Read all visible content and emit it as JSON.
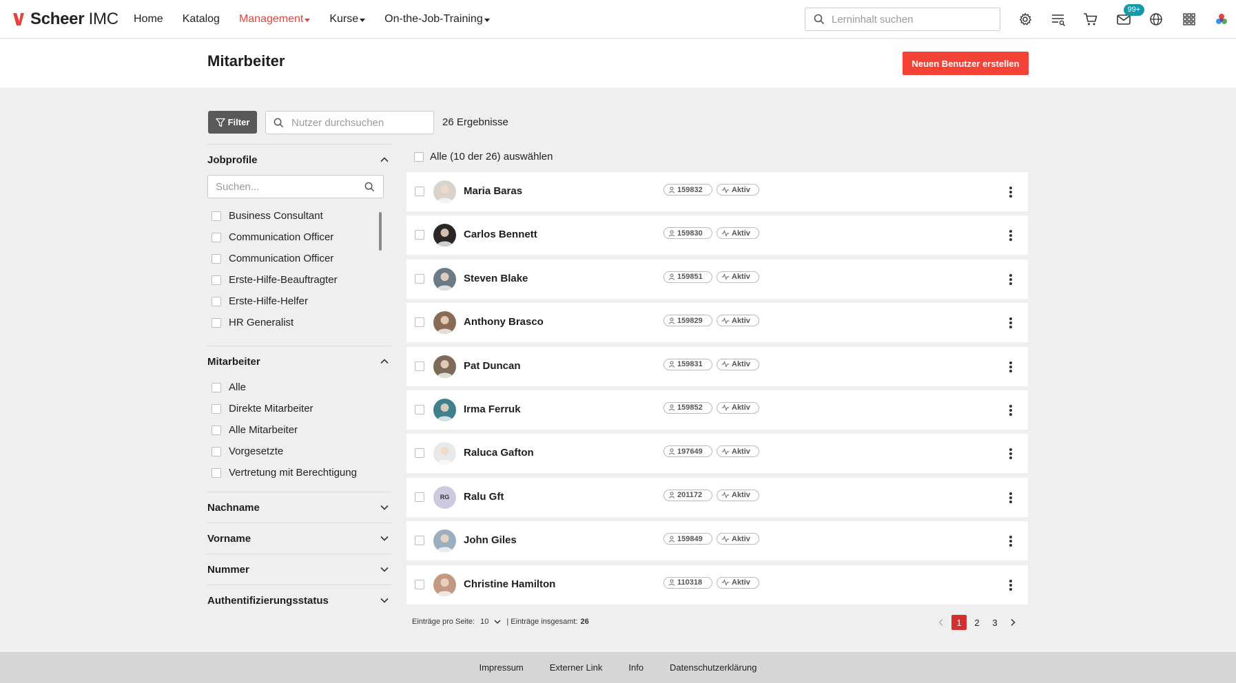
{
  "header": {
    "logo_brand": "Scheer",
    "logo_suffix": "IMC",
    "nav": [
      {
        "label": "Home"
      },
      {
        "label": "Katalog"
      },
      {
        "label": "Management"
      },
      {
        "label": "Kurse"
      },
      {
        "label": "On-the-Job-Training"
      }
    ],
    "active_nav": "Management",
    "search_placeholder": "Lerninhalt suchen",
    "icons": [
      "gear-icon",
      "filter-list-icon",
      "cart-icon",
      "mail-icon",
      "globe-icon",
      "apps-grid-icon",
      "brand-icon"
    ],
    "mail_badge": "99+"
  },
  "page": {
    "title": "Mitarbeiter",
    "create_button": "Neuen Benutzer erstellen",
    "filter_button": "Filter",
    "user_search_placeholder": "Nutzer durchsuchen",
    "results": "26 Ergebnisse",
    "select_all": "Alle (10 der 26) auswählen"
  },
  "sidebar": {
    "jobprofile": {
      "title": "Jobprofile",
      "search_placeholder": "Suchen...",
      "items": [
        {
          "label": "Business Consultant"
        },
        {
          "label": "Communication Officer"
        },
        {
          "label": "Communication Officer"
        },
        {
          "label": "Erste-Hilfe-Beauftragter"
        },
        {
          "label": "Erste-Hilfe-Helfer"
        },
        {
          "label": "HR Generalist"
        }
      ]
    },
    "mitarbeiter": {
      "title": "Mitarbeiter",
      "items": [
        {
          "label": "Alle"
        },
        {
          "label": "Direkte Mitarbeiter"
        },
        {
          "label": "Alle Mitarbeiter"
        },
        {
          "label": "Vorgesetzte"
        },
        {
          "label": "Vertretung mit Berechtigung"
        }
      ]
    },
    "collapsed": [
      {
        "title": "Nachname"
      },
      {
        "title": "Vorname"
      },
      {
        "title": "Nummer"
      },
      {
        "title": "Authentifizierungsstatus"
      }
    ]
  },
  "users": [
    {
      "name": "Maria Baras",
      "id": "159832",
      "status": "Aktiv",
      "avatar_color": "#d9d3cc",
      "initials": ""
    },
    {
      "name": "Carlos Bennett",
      "id": "159830",
      "status": "Aktiv",
      "avatar_color": "#2b2623",
      "initials": ""
    },
    {
      "name": "Steven Blake",
      "id": "159851",
      "status": "Aktiv",
      "avatar_color": "#6c7a86",
      "initials": ""
    },
    {
      "name": "Anthony Brasco",
      "id": "159829",
      "status": "Aktiv",
      "avatar_color": "#8a6b55",
      "initials": ""
    },
    {
      "name": "Pat Duncan",
      "id": "159831",
      "status": "Aktiv",
      "avatar_color": "#7d6a58",
      "initials": ""
    },
    {
      "name": "Irma Ferruk",
      "id": "159852",
      "status": "Aktiv",
      "avatar_color": "#3f7f8e",
      "initials": ""
    },
    {
      "name": "Raluca Gafton",
      "id": "197649",
      "status": "Aktiv",
      "avatar_color": "#e9e9e9",
      "initials": ""
    },
    {
      "name": "Ralu Gft",
      "id": "201172",
      "status": "Aktiv",
      "avatar_color": "#cfc9e0",
      "initials": "RG"
    },
    {
      "name": "John Giles",
      "id": "159849",
      "status": "Aktiv",
      "avatar_color": "#9aaebf",
      "initials": ""
    },
    {
      "name": "Christine Hamilton",
      "id": "110318",
      "status": "Aktiv",
      "avatar_color": "#c29a84",
      "initials": ""
    }
  ],
  "pagination": {
    "per_page_label": "Einträge pro Seite:",
    "per_page_value": "10",
    "total_label": "| Einträge insgesamt:",
    "total_value": "26",
    "pages": [
      "1",
      "2",
      "3"
    ],
    "current_page": "1"
  },
  "footer": {
    "links": [
      {
        "label": "Impressum"
      },
      {
        "label": "Externer Link"
      },
      {
        "label": "Info"
      },
      {
        "label": "Datenschutzerklärung"
      }
    ]
  },
  "colors": {
    "accent": "#f44336",
    "active_nav": "#e5443e",
    "badge": "#1598a8",
    "filter_button": "#595959",
    "page_active": "#d32f2f"
  }
}
